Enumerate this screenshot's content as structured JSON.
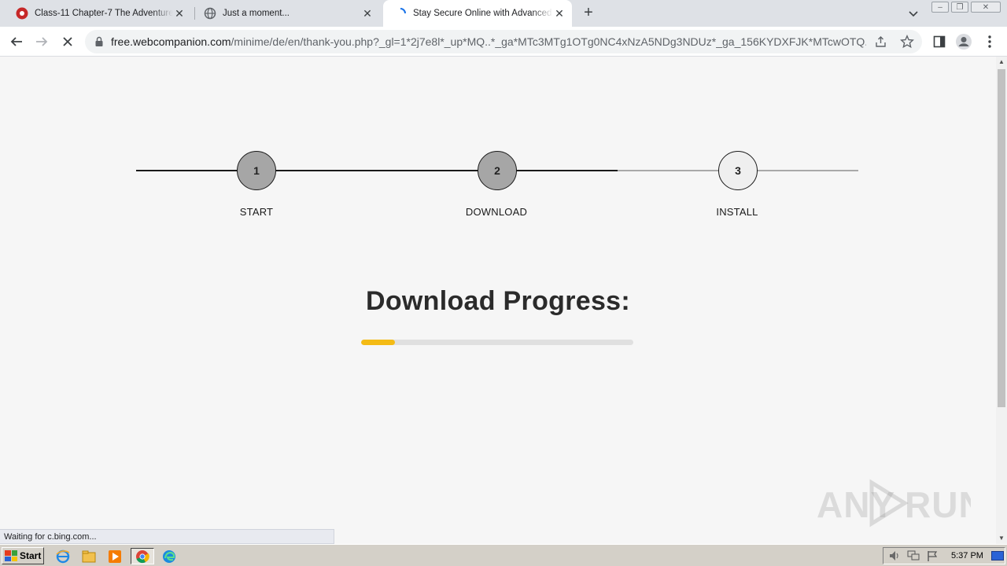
{
  "browser": {
    "tabs": [
      {
        "title": "Class-11 Chapter-7 The Adventure-I",
        "active": false
      },
      {
        "title": "Just a moment...",
        "active": false
      },
      {
        "title": "Stay Secure Online with Advanced A",
        "active": true
      }
    ],
    "url_host": "free.webcompanion.com",
    "url_path": "/minime/de/en/thank-you.php?_gl=1*2j7e8l*_up*MQ..*_ga*MTc3MTg1OTg0NC4xNzA5NDg3NDUz*_ga_156KYDXFJK*MTcwOTQ...",
    "status_text": "Waiting for c.bing.com..."
  },
  "page": {
    "steps": [
      {
        "number": "1",
        "label": "START",
        "state": "done"
      },
      {
        "number": "2",
        "label": "DOWNLOAD",
        "state": "done"
      },
      {
        "number": "3",
        "label": "INSTALL",
        "state": "pending"
      }
    ],
    "heading": "Download Progress:",
    "progress_fraction": 0.125,
    "progress_color": "#f4bb15"
  },
  "watermark": "ANY RUN",
  "taskbar": {
    "start_label": "Start",
    "apps": [
      "ie-icon",
      "explorer-icon",
      "media-player-icon",
      "chrome-icon",
      "edge-icon"
    ],
    "clock": "5:37 PM"
  }
}
